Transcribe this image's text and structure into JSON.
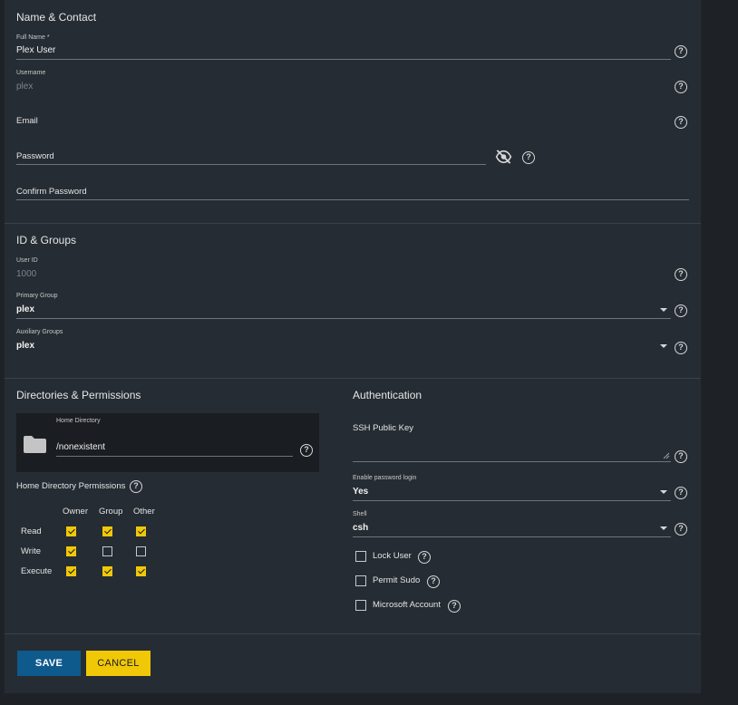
{
  "name_contact": {
    "heading": "Name & Contact",
    "full_name_label": "Full Name *",
    "full_name_value": "Plex User",
    "username_label": "Username",
    "username_value": "plex",
    "email_label": "Email",
    "password_label": "Password",
    "confirm_password_label": "Confirm Password"
  },
  "id_groups": {
    "heading": "ID & Groups",
    "user_id_label": "User ID",
    "user_id_value": "1000",
    "primary_group_label": "Primary Group",
    "primary_group_value": "plex",
    "aux_groups_label": "Auxiliary Groups",
    "aux_groups_value": "plex"
  },
  "directories": {
    "heading": "Directories & Permissions",
    "home_dir_label": "Home Directory",
    "home_dir_value": "/nonexistent",
    "permissions_label": "Home Directory Permissions",
    "columns": [
      "Owner",
      "Group",
      "Other"
    ],
    "rows": [
      {
        "label": "Read",
        "values": [
          true,
          true,
          true
        ]
      },
      {
        "label": "Write",
        "values": [
          true,
          false,
          false
        ]
      },
      {
        "label": "Execute",
        "values": [
          true,
          true,
          true
        ]
      }
    ]
  },
  "authentication": {
    "heading": "Authentication",
    "ssh_key_label": "SSH Public Key",
    "password_login_label": "Enable password login",
    "password_login_value": "Yes",
    "shell_label": "Shell",
    "shell_value": "csh",
    "lock_user_label": "Lock User",
    "lock_user_checked": false,
    "permit_sudo_label": "Permit Sudo",
    "permit_sudo_checked": false,
    "microsoft_account_label": "Microsoft Account",
    "microsoft_account_checked": false
  },
  "actions": {
    "save_label": "SAVE",
    "cancel_label": "CANCEL"
  },
  "icons": {
    "help": "help-circle-icon",
    "eye_off": "eye-off-icon",
    "folder": "folder-icon",
    "dropdown": "caret-down-icon"
  },
  "colors": {
    "panel": "#252c33",
    "background": "#1e2226",
    "accent_yellow": "#f0c808",
    "primary_blue": "#0f5a8c"
  }
}
